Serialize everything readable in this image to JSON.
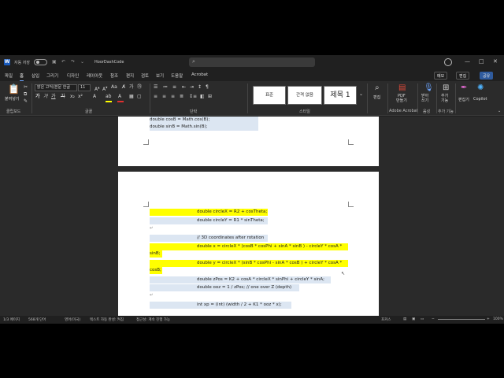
{
  "titlebar": {
    "word_logo": "W",
    "autosave_label": "자동 저장",
    "doc_title": "HoorDashCode",
    "search_placeholder": ""
  },
  "tabs": [
    "파일",
    "홈",
    "삽입",
    "그리기",
    "디자인",
    "레이아웃",
    "참조",
    "편지",
    "검토",
    "보기",
    "도움말",
    "Acrobat"
  ],
  "active_tab": "홈",
  "ribbon_buttons": {
    "memo": "메모",
    "edit": "편집",
    "share": "공유"
  },
  "ribbon": {
    "paste_label": "붙여넣기",
    "font_name": "맑은 고딕(본문 한글",
    "font_size": "11",
    "styles": [
      "표준",
      "간격 없음",
      "제목 1"
    ],
    "find_label": "편집",
    "pdf_label": "PDF\n만들기",
    "dictate_label": "받아\n쓰기",
    "addins_label": "추가\n기능",
    "editor_label": "편집기",
    "copilot_label": "Copilot",
    "groups": {
      "clipboard": "클립보드",
      "font": "글꼴",
      "paragraph": "단락",
      "styles": "스타일",
      "acrobat": "Adobe Acrobat",
      "voice": "음성",
      "addins": "추가 기능"
    }
  },
  "page1_lines": [
    {
      "text": "double cosB = Math.cos(B);",
      "highlight": "blue"
    },
    {
      "text": "double sinB = Math.sin(B);",
      "highlight": "blue"
    }
  ],
  "page2_lines": [
    {
      "text": "double circleX = R2 + cosTheta;",
      "highlight": "yellow"
    },
    {
      "text": "double circleY = R1 * sinTheta;",
      "highlight": "blue"
    },
    {
      "text": "↵",
      "highlight": "none"
    },
    {
      "text": "// 3D coordinates after rotation",
      "highlight": "blue"
    },
    {
      "text": "double x = circleX * (cosB * cosPhi + sinA * sinB ) - circleY * cosA *",
      "highlight": "yellow"
    },
    {
      "text": "sinB;",
      "highlight": "yellow"
    },
    {
      "text": "double y = circleX * (sinB * cosPhi - sinA * cosB ) + circleY * cosA *",
      "highlight": "yellow"
    },
    {
      "text": "cosB;",
      "highlight": "yellow"
    },
    {
      "text": "double zPos = K2 + cosA * circleX * sinPhi + circleY * sinA;",
      "highlight": "blue"
    },
    {
      "text": "double ooz = 1 / zPos; // one over Z (depth)",
      "highlight": "blue"
    },
    {
      "text": "↵",
      "highlight": "none"
    },
    {
      "text": "int xp = (int) (width / 2 + K1 * ooz * x);",
      "highlight": "blue"
    }
  ],
  "statusbar": {
    "page": "1/3 페이지",
    "words": "568개 단어",
    "language": "영어(미국)",
    "text_pred": "텍스트 자동 완성: 켜짐",
    "accessibility": "접근성: 계속 진행 가능",
    "focus": "포커스",
    "zoom": "100%"
  },
  "colors": {
    "highlight_yellow": "#ffff00",
    "highlight_blue": "#dce6f2",
    "accent": "#185abd"
  }
}
